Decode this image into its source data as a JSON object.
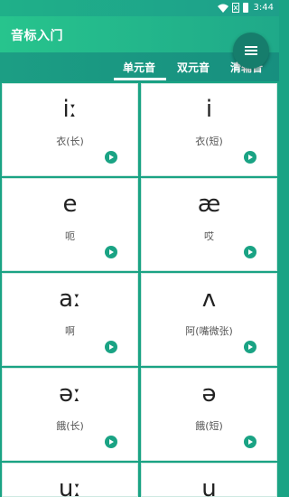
{
  "status": {
    "time": "3:44"
  },
  "app": {
    "title": "音标入门"
  },
  "tabs": [
    {
      "label": "单元音"
    },
    {
      "label": "双元音"
    },
    {
      "label": "清辅音"
    }
  ],
  "cards": [
    {
      "symbol": "iː",
      "label": "衣(长)"
    },
    {
      "symbol": "i",
      "label": "衣(短)"
    },
    {
      "symbol": "e",
      "label": "呃"
    },
    {
      "symbol": "æ",
      "label": "哎"
    },
    {
      "symbol": "aː",
      "label": "啊"
    },
    {
      "symbol": "ʌ",
      "label": "阿(嘴微张)"
    },
    {
      "symbol": "əː",
      "label": "餓(长)"
    },
    {
      "symbol": "ə",
      "label": "餓(短)"
    },
    {
      "symbol": "uː",
      "label": ""
    },
    {
      "symbol": "u",
      "label": ""
    }
  ],
  "colors": {
    "accent": "#1aa384",
    "appbar": "#27c48d",
    "fab": "#167d6c"
  },
  "icons": {
    "menu": "menu-icon",
    "play": "play-icon",
    "wifi": "wifi-icon",
    "battery": "battery-icon"
  }
}
